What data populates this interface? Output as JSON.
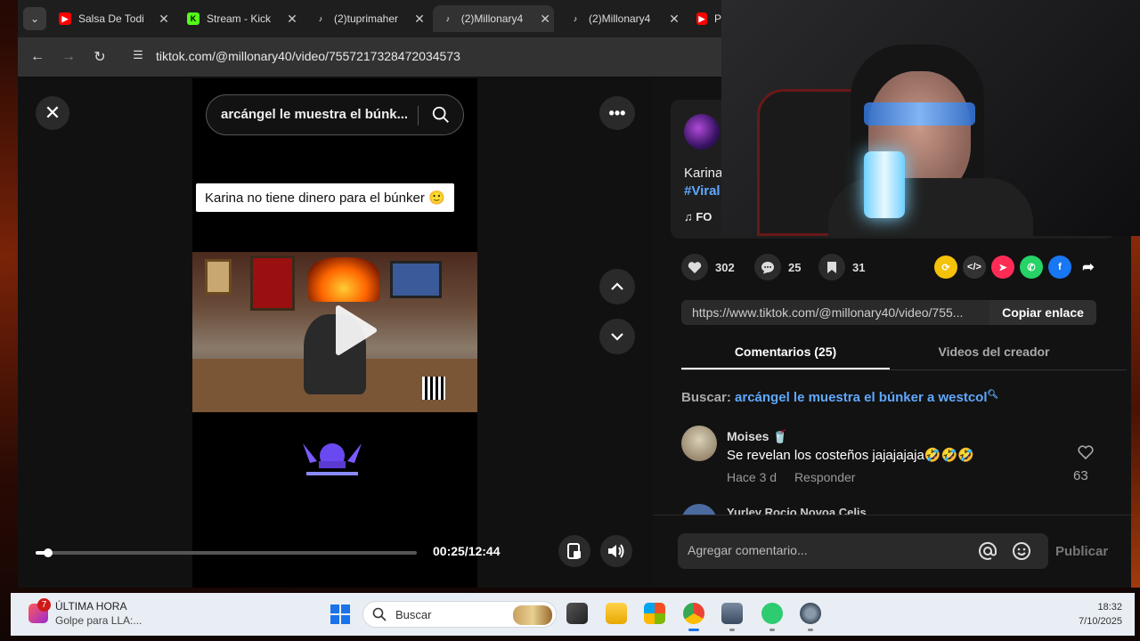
{
  "browser": {
    "tabs": [
      {
        "label": "Salsa De Todi",
        "icon": "youtube-icon",
        "color": "#ff0000"
      },
      {
        "label": "Stream - Kick",
        "icon": "kick-icon",
        "color": "#53fc18"
      },
      {
        "label": "(2)tuprimaher",
        "icon": "tiktok-icon",
        "color": "#ffffff"
      },
      {
        "label": "(2)Millonary4",
        "icon": "tiktok-icon",
        "color": "#ffffff",
        "active": true
      },
      {
        "label": "(2)Millonary4",
        "icon": "tiktok-icon",
        "color": "#ffffff"
      },
      {
        "label": "P",
        "icon": "youtube-icon",
        "color": "#ff0000"
      }
    ],
    "url": "tiktok.com/@millonary40/video/7557217328472034573"
  },
  "player": {
    "search_query": "arcángel le muestra el búnk...",
    "caption": "Karina no tiene dinero para el búnker 🙂",
    "time": "00:25/12:44",
    "progress": 0.033
  },
  "panel": {
    "author_name": "Karina",
    "hashtag": "#Viral",
    "music": "♫ FO",
    "likes": "302",
    "comments_count": "25",
    "saves": "31",
    "share_link": "https://www.tiktok.com/@millonary40/video/755...",
    "copy_label": "Copiar enlace",
    "tab_comments": "Comentarios (25)",
    "tab_videos": "Videos del creador",
    "search_label": "Buscar:",
    "search_value": "arcángel le muestra el búnker a westcol",
    "comment": {
      "author": "Moises",
      "badge": "🥤",
      "text": "Se revelan los costeños jajajajaja🤣🤣🤣",
      "time": "Hace 3 d",
      "reply": "Responder",
      "likes": "63"
    },
    "next_comment_author": "Yurley Rocio Novoa Celis",
    "compose_placeholder": "Agregar comentario...",
    "publish_label": "Publicar"
  },
  "taskbar": {
    "news_badge": "7",
    "news_title": "ÚLTIMA HORA",
    "news_sub": "Golpe para LLA:...",
    "search_label": "Buscar",
    "time": "18:32",
    "date": "7/10/2025"
  }
}
